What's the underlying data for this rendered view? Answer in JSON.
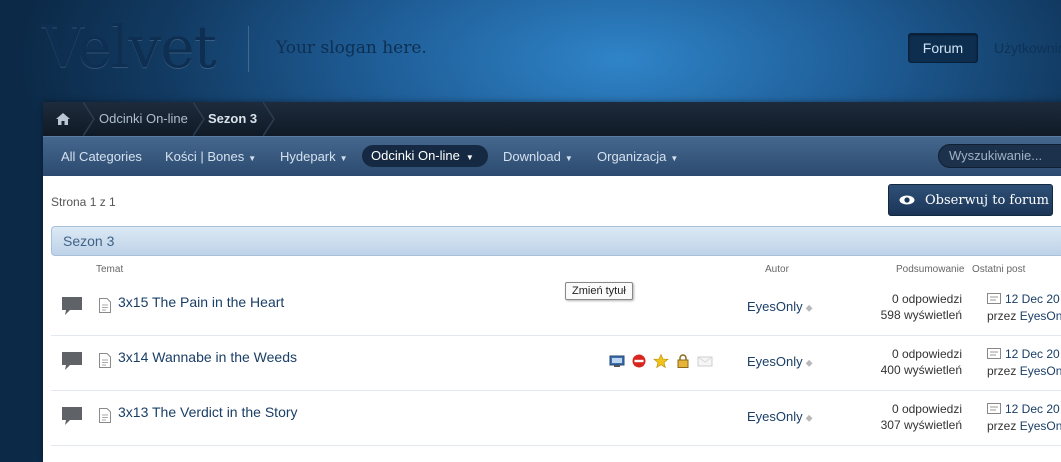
{
  "header": {
    "logo": "Velvet",
    "slogan": "Your slogan here.",
    "nav_forum": "Forum",
    "nav_users": "Użytkownicy"
  },
  "breadcrumb": {
    "items": [
      "Odcinki On-line",
      "Sezon 3"
    ]
  },
  "nav": {
    "items": [
      "All Categories",
      "Kości | Bones",
      "Hydepark",
      "Odcinki On-line",
      "Download",
      "Organizacja"
    ],
    "search_placeholder": "Wyszukiwanie..."
  },
  "page": {
    "page_info": "Strona 1 z 1",
    "watch_label": "Obserwuj to forum",
    "category_title": "Sezon 3"
  },
  "columns": {
    "topic": "Temat",
    "author": "Autor",
    "summary": "Podsumowanie",
    "last_post": "Ostatni post"
  },
  "threads": [
    {
      "title": "3x15 The Pain in the Heart",
      "author": "EyesOnly",
      "replies": "0 odpowiedzi",
      "views": "598 wyświetleń",
      "last_date": "12 Dec 20",
      "last_by_prefix": "przez",
      "last_by": "EyesOn"
    },
    {
      "title": "3x14 Wannabe in the Weeds",
      "author": "EyesOnly",
      "replies": "0 odpowiedzi",
      "views": "400 wyświetleń",
      "last_date": "12 Dec 20",
      "last_by_prefix": "przez",
      "last_by": "EyesOn"
    },
    {
      "title": "3x13 The Verdict in the Story",
      "author": "EyesOnly",
      "replies": "0 odpowiedzi",
      "views": "307 wyświetleń",
      "last_date": "12 Dec 20",
      "last_by_prefix": "przez",
      "last_by": "EyesOn"
    }
  ],
  "tooltip": "Zmień tytuł",
  "icons": {
    "home": "home-icon",
    "watch": "eye-icon",
    "thread": "speech-bubble-icon",
    "doc": "document-icon",
    "mod": [
      "monitor-icon",
      "stop-icon",
      "star-icon",
      "lock-icon",
      "envelope-icon"
    ]
  }
}
